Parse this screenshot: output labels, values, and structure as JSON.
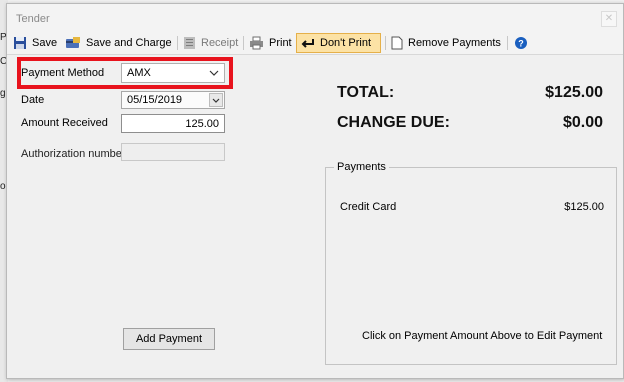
{
  "window": {
    "title": "Tender"
  },
  "background_fragments": [
    "PI",
    "CC",
    "g L",
    "og"
  ],
  "toolbar": {
    "save": "Save",
    "save_and_charge": "Save and Charge",
    "receipt": "Receipt",
    "print": "Print",
    "dont_print": "Don't Print",
    "remove_payments": "Remove Payments"
  },
  "form": {
    "payment_method_label": "Payment Method",
    "payment_method_value": "AMX",
    "date_label": "Date",
    "date_value": "05/15/2019",
    "amount_label": "Amount Received",
    "amount_value": "125.00",
    "auth_label": "Authorization number",
    "auth_value": ""
  },
  "summary": {
    "total_label": "TOTAL:",
    "total_value": "$125.00",
    "change_label": "CHANGE DUE:",
    "change_value": "$0.00"
  },
  "payments": {
    "group_title": "Payments",
    "rows": [
      {
        "method": "Credit Card",
        "amount": "$125.00"
      }
    ],
    "hint": "Click on Payment Amount Above to Edit Payment"
  },
  "add_payment_label": "Add Payment",
  "colors": {
    "highlight": "#e8131d",
    "active_button": "#fce2a5",
    "help_icon": "#1a5fbf"
  }
}
